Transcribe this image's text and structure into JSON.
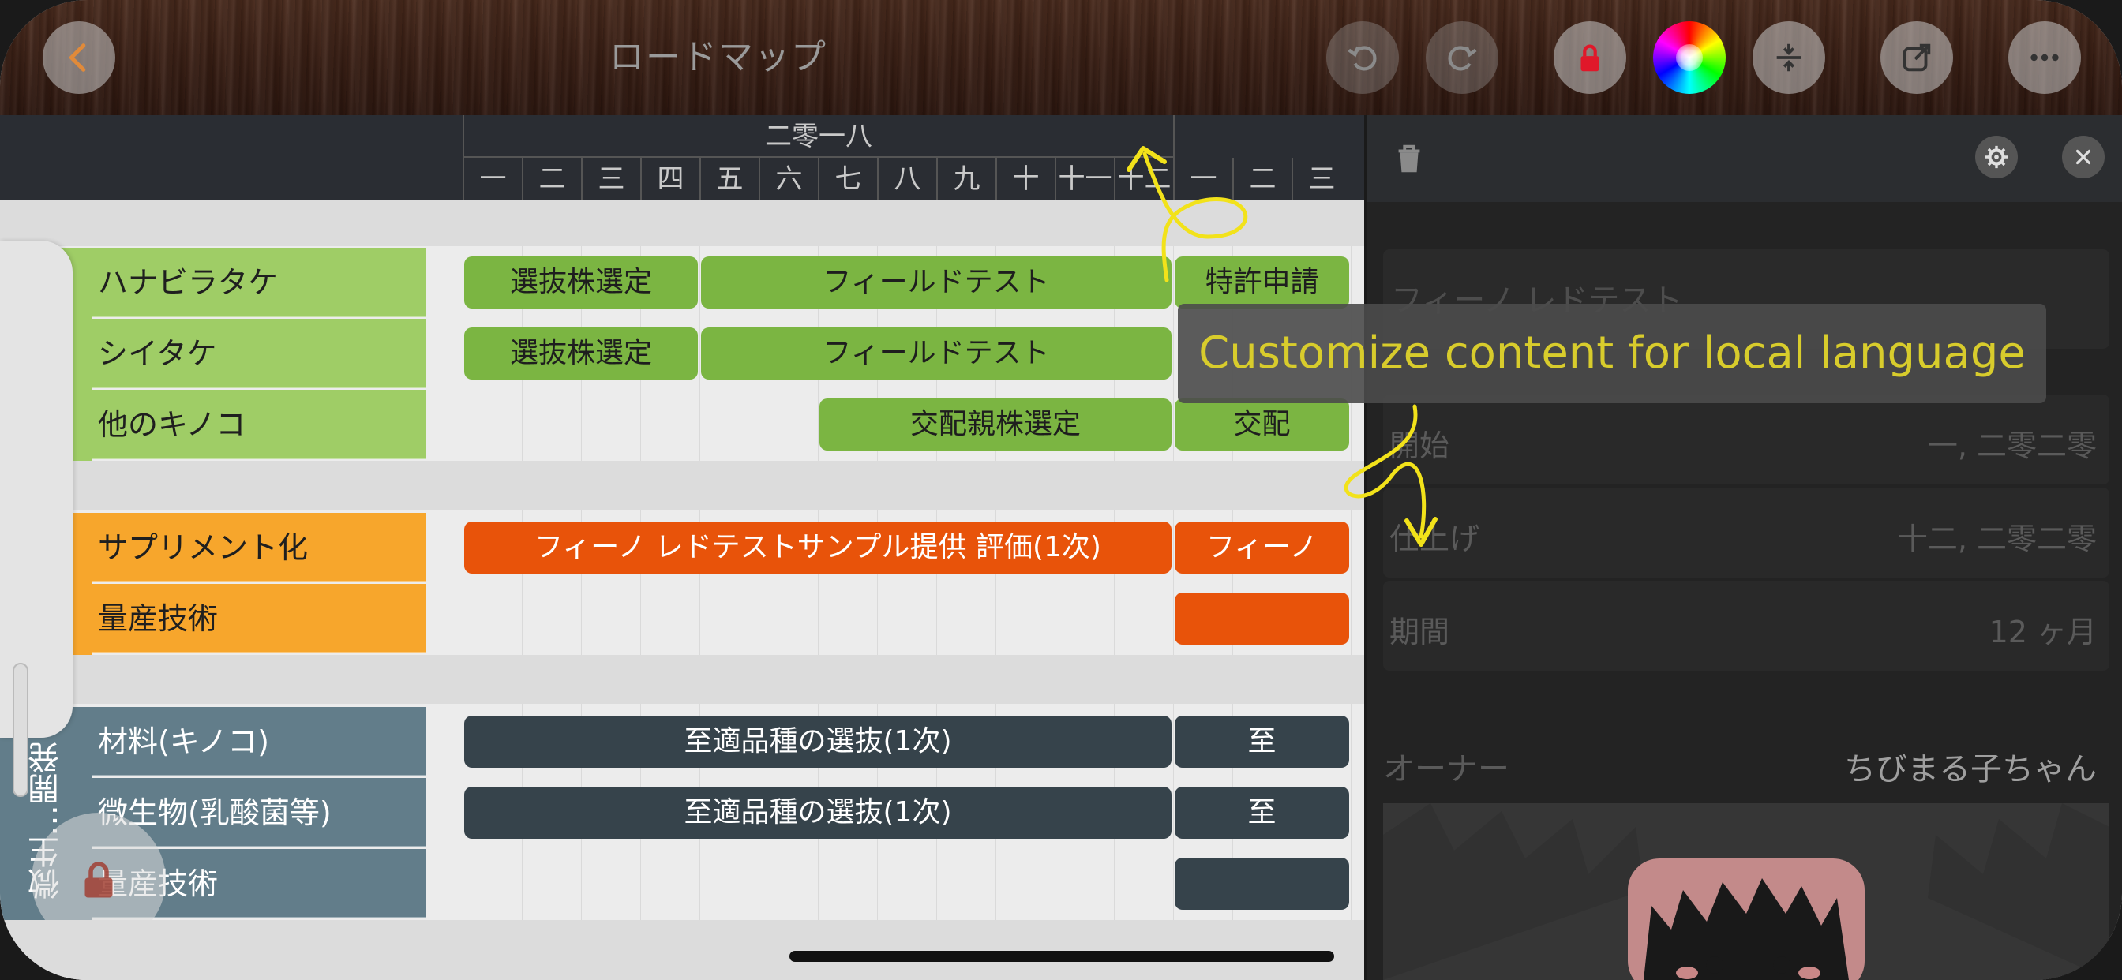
{
  "toolbar": {
    "title": "ロードマップ",
    "buttons": [
      "back-icon",
      "undo-icon",
      "redo-icon",
      "lock-icon",
      "color-wheel-icon",
      "resize-rows-icon",
      "share-icon",
      "more-icon"
    ]
  },
  "timeline": {
    "year": "二零一八",
    "months": [
      "一",
      "二",
      "三",
      "四",
      "五",
      "六",
      "七",
      "八",
      "九",
      "十",
      "十一",
      "十二",
      "一",
      "二",
      "三"
    ]
  },
  "groups": [
    {
      "color": "#9fcd66",
      "rows": [
        {
          "label": "ハナビラタケ",
          "bars": [
            {
              "text": "選抜株選定"
            },
            {
              "text": "フィールドテスト"
            },
            {
              "text": "特許申請"
            }
          ]
        },
        {
          "label": "シイタケ",
          "bars": [
            {
              "text": "選抜株選定"
            },
            {
              "text": "フィールドテスト"
            }
          ]
        },
        {
          "label": "他のキノコ",
          "bars": [
            {
              "text": "交配親株選定"
            },
            {
              "text": "交配"
            }
          ]
        }
      ]
    },
    {
      "color": "#f7a62c",
      "rows": [
        {
          "label": "サプリメント化",
          "bars": [
            {
              "text": "フィーノ レドテストサンプル提供 評価(1次)"
            },
            {
              "text": "フィーノ"
            }
          ]
        },
        {
          "label": "量産技術",
          "bars": [
            {
              "text": ""
            }
          ]
        }
      ]
    },
    {
      "color": "#627d8a",
      "vertical_label": "微生…開発",
      "rows": [
        {
          "label": "材料(キノコ)",
          "bars": [
            {
              "text": "至適品種の選抜(1次)"
            },
            {
              "text": "至"
            }
          ]
        },
        {
          "label": "微生物(乳酸菌等)",
          "bars": [
            {
              "text": "至適品種の選抜(1次)"
            },
            {
              "text": "至"
            }
          ]
        },
        {
          "label": "量産技術",
          "bars": [
            {
              "text": ""
            }
          ]
        }
      ]
    }
  ],
  "panel": {
    "title_value": "フィーノ レドテスト",
    "start_label": "開始",
    "start_value": "一, 二零二零",
    "finish_label": "仕上げ",
    "finish_value": "十二, 二零二零",
    "duration_label": "期間",
    "duration_value": "12 ヶ月",
    "owner_label": "オーナー",
    "owner_value": "ちびまる子ちゃん"
  },
  "tooltip": {
    "text": "Customize content for local language"
  },
  "colors": {
    "accent_arrow": "#f2e21a",
    "bar_green": "#7bb542",
    "bar_orange": "#e8530a",
    "bar_slate": "#36434b"
  }
}
